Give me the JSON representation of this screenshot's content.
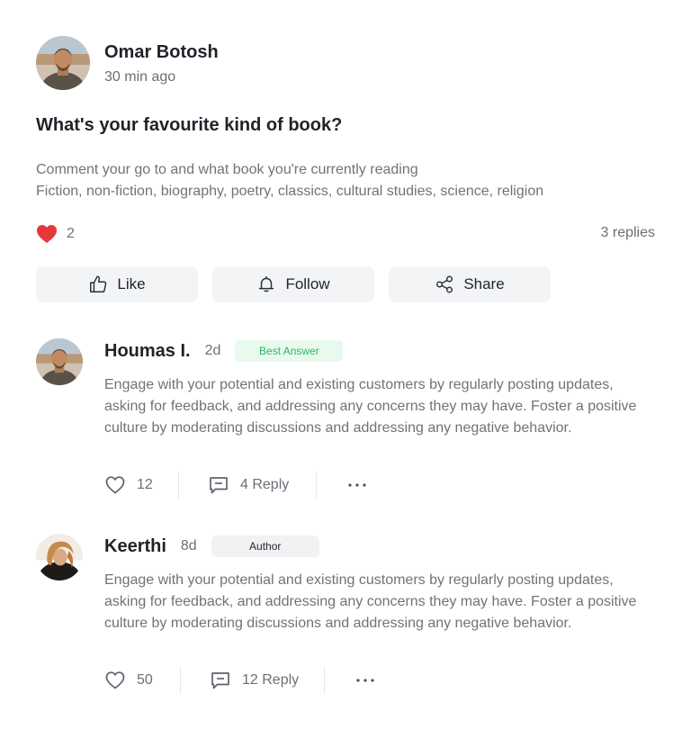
{
  "post": {
    "author": "Omar Botosh",
    "time": "30 min ago",
    "title": "What's your favourite kind of book?",
    "body_line1": "Comment your go to and what book you're currently reading",
    "body_line2": "Fiction, non-fiction, biography, poetry, classics, cultural studies, science, religion",
    "likes": "2",
    "replies": "3 replies"
  },
  "actions": {
    "like": "Like",
    "follow": "Follow",
    "share": "Share"
  },
  "comments": [
    {
      "author": "Houmas I.",
      "age": "2d",
      "badge": "Best Answer",
      "text": "Engage with your potential and existing customers by regularly posting updates, asking for feedback, and addressing any concerns they may have. Foster a positive culture by moderating discussions and addressing any negative behavior.",
      "likes": "12",
      "reply": "4 Reply"
    },
    {
      "author": "Keerthi",
      "age": "8d",
      "badge": "Author",
      "text": "Engage with your potential and existing customers by regularly posting updates, asking for feedback, and addressing any concerns they may have. Foster a positive culture by moderating discussions and addressing any negative behavior.",
      "likes": "50",
      "reply": "12 Reply"
    }
  ],
  "colors": {
    "heart": "#e5383b",
    "best_answer_bg": "#e8f9ee",
    "best_answer_text": "#2fb85c",
    "button_bg": "#f3f4f6"
  },
  "icons": [
    "heart-filled-icon",
    "thumbs-up-icon",
    "bell-icon",
    "share-icon",
    "heart-outline-icon",
    "comment-icon",
    "more-icon"
  ]
}
